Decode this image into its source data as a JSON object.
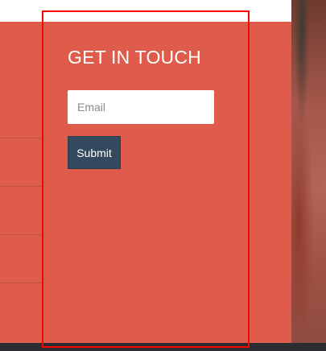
{
  "contact": {
    "heading": "GET IN TOUCH",
    "email_placeholder": "Email",
    "email_value": "",
    "submit_label": "Submit"
  },
  "colors": {
    "panel_background": "#df5b4b",
    "button_background": "#34495e",
    "highlight_border": "#ff0000",
    "text": "#ffffff"
  }
}
